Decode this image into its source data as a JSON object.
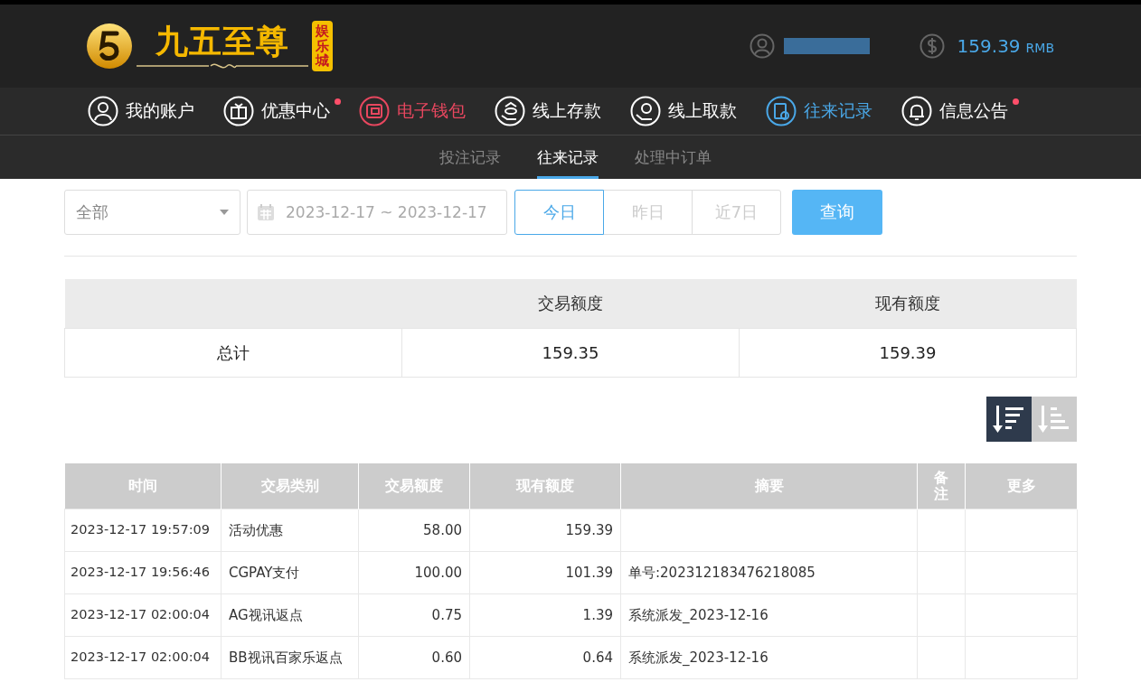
{
  "header": {
    "logo_title": "九五至尊",
    "logo_badge": "娱乐城",
    "balance": "159.39",
    "currency": "RMB"
  },
  "nav": [
    {
      "label": "我的账户",
      "kind": "user",
      "color": "#ffffff",
      "dot": false
    },
    {
      "label": "优惠中心",
      "kind": "gift",
      "color": "#ffffff",
      "dot": true
    },
    {
      "label": "电子钱包",
      "kind": "wallet",
      "color": "#e8475f",
      "dot": false
    },
    {
      "label": "线上存款",
      "kind": "deposit",
      "color": "#ffffff",
      "dot": false
    },
    {
      "label": "线上取款",
      "kind": "withdraw",
      "color": "#ffffff",
      "dot": false
    },
    {
      "label": "往来记录",
      "kind": "record",
      "color": "#4aa8e8",
      "dot": false
    },
    {
      "label": "信息公告",
      "kind": "bell",
      "color": "#ffffff",
      "dot": true
    }
  ],
  "tabs": [
    {
      "label": "投注记录",
      "selected": false
    },
    {
      "label": "往来记录",
      "selected": true
    },
    {
      "label": "处理中订单",
      "selected": false
    }
  ],
  "filter": {
    "type_select": "全部",
    "date_range": "2023-12-17 ~ 2023-12-17",
    "quick_ranges": [
      {
        "label": "今日",
        "selected": true
      },
      {
        "label": "昨日",
        "selected": false
      },
      {
        "label": "近7日",
        "selected": false
      }
    ],
    "query_button": "查询"
  },
  "summary": {
    "columns": [
      "交易额度",
      "现有额度"
    ],
    "row": [
      "总计",
      "159.35",
      "159.39"
    ]
  },
  "sort_buttons": [
    {
      "kind": "desc",
      "selected": true
    },
    {
      "kind": "asc",
      "selected": false
    }
  ],
  "table": {
    "columns": [
      "时间",
      "交易类别",
      "交易额度",
      "现有额度",
      "摘要",
      "备注",
      "更多"
    ],
    "rows": [
      [
        "2023-12-17 19:57:09",
        "活动优惠",
        "58.00",
        "159.39",
        ""
      ],
      [
        "2023-12-17 19:56:46",
        "CGPAY支付",
        "100.00",
        "101.39",
        "单号:202312183476218085"
      ],
      [
        "2023-12-17 02:00:04",
        "AG视讯返点",
        "0.75",
        "1.39",
        "系统派发_2023-12-16"
      ],
      [
        "2023-12-17 02:00:04",
        "BB视讯百家乐返点",
        "0.60",
        "0.64",
        "系统派发_2023-12-16"
      ]
    ]
  }
}
